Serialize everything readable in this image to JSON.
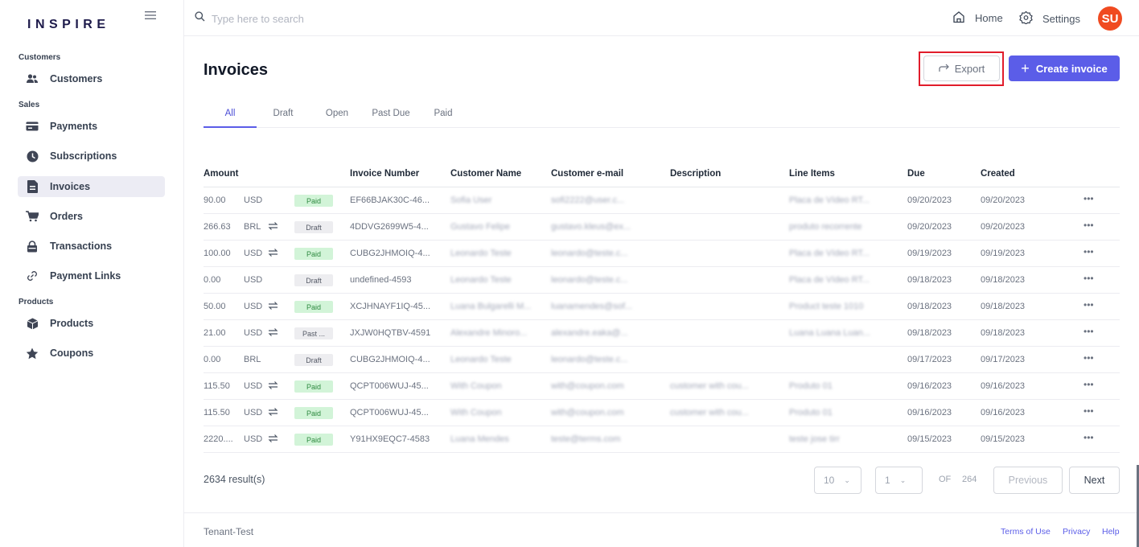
{
  "brand": {
    "logo": "INSPIRE"
  },
  "sidebar": {
    "sections": [
      {
        "label": "Customers",
        "items": [
          {
            "label": "Customers",
            "icon": "users-icon"
          }
        ]
      },
      {
        "label": "Sales",
        "items": [
          {
            "label": "Payments",
            "icon": "credit-card-icon"
          },
          {
            "label": "Subscriptions",
            "icon": "clock-icon"
          },
          {
            "label": "Invoices",
            "icon": "document-icon",
            "active": true
          },
          {
            "label": "Orders",
            "icon": "cart-icon"
          },
          {
            "label": "Transactions",
            "icon": "lock-icon"
          },
          {
            "label": "Payment Links",
            "icon": "link-icon"
          }
        ]
      },
      {
        "label": "Products",
        "items": [
          {
            "label": "Products",
            "icon": "cube-icon"
          },
          {
            "label": "Coupons",
            "icon": "star-icon"
          }
        ]
      }
    ]
  },
  "topbar": {
    "search_placeholder": "Type here to search",
    "home_label": "Home",
    "settings_label": "Settings",
    "avatar_initials": "SU"
  },
  "page": {
    "title": "Invoices",
    "export_label": "Export",
    "create_label": "Create invoice"
  },
  "tabs": [
    "All",
    "Draft",
    "Open",
    "Past Due",
    "Paid"
  ],
  "table": {
    "columns": [
      "Amount",
      "Invoice Number",
      "Customer Name",
      "Customer e-mail",
      "Description",
      "Line Items",
      "Due",
      "Created"
    ],
    "rows": [
      {
        "amount": "90.00",
        "currency": "USD",
        "recurring": false,
        "status": "Paid",
        "invoice": "EF66BJAK30C-46...",
        "name": "Sofia User",
        "email": "sofi2222@user.c...",
        "description": "",
        "line_items": "Placa de Vídeo RT...",
        "due": "09/20/2023",
        "created": "09/20/2023"
      },
      {
        "amount": "266.63",
        "currency": "BRL",
        "recurring": true,
        "status": "Draft",
        "invoice": "4DDVG2699W5-4...",
        "name": "Gustavo Felipe",
        "email": "gustavo.kleus@ex...",
        "description": "",
        "line_items": "produto recorrente",
        "due": "09/20/2023",
        "created": "09/20/2023"
      },
      {
        "amount": "100.00",
        "currency": "USD",
        "recurring": true,
        "status": "Paid",
        "invoice": "CUBG2JHMOIQ-4...",
        "name": "Leonardo Teste",
        "email": "leonardo@teste.c...",
        "description": "",
        "line_items": "Placa de Vídeo RT...",
        "due": "09/19/2023",
        "created": "09/19/2023"
      },
      {
        "amount": "0.00",
        "currency": "USD",
        "recurring": false,
        "status": "Draft",
        "invoice": "undefined-4593",
        "name": "Leonardo Teste",
        "email": "leonardo@teste.c...",
        "description": "",
        "line_items": "Placa de Vídeo RT...",
        "due": "09/18/2023",
        "created": "09/18/2023"
      },
      {
        "amount": "50.00",
        "currency": "USD",
        "recurring": true,
        "status": "Paid",
        "invoice": "XCJHNAYF1IQ-45...",
        "name": "Luana Bulgarelli M...",
        "email": "luanamendes@sof...",
        "description": "",
        "line_items": "Product teste 1010",
        "due": "09/18/2023",
        "created": "09/18/2023"
      },
      {
        "amount": "21.00",
        "currency": "USD",
        "recurring": true,
        "status": "Past ...",
        "invoice": "JXJW0HQTBV-4591",
        "name": "Alexandre Minoro...",
        "email": "alexandre.eaka@...",
        "description": "",
        "line_items": "Luana Luana Luan...",
        "due": "09/18/2023",
        "created": "09/18/2023"
      },
      {
        "amount": "0.00",
        "currency": "BRL",
        "recurring": false,
        "status": "Draft",
        "invoice": "CUBG2JHMOIQ-4...",
        "name": "Leonardo Teste",
        "email": "leonardo@teste.c...",
        "description": "",
        "line_items": "",
        "due": "09/17/2023",
        "created": "09/17/2023"
      },
      {
        "amount": "115.50",
        "currency": "USD",
        "recurring": true,
        "status": "Paid",
        "invoice": "QCPT006WUJ-45...",
        "name": "With Coupon",
        "email": "with@coupon.com",
        "description": "customer with cou...",
        "line_items": "Produto 01",
        "due": "09/16/2023",
        "created": "09/16/2023"
      },
      {
        "amount": "115.50",
        "currency": "USD",
        "recurring": true,
        "status": "Paid",
        "invoice": "QCPT006WUJ-45...",
        "name": "With Coupon",
        "email": "with@coupon.com",
        "description": "customer with cou...",
        "line_items": "Produto 01",
        "due": "09/16/2023",
        "created": "09/16/2023"
      },
      {
        "amount": "2220....",
        "currency": "USD",
        "recurring": true,
        "status": "Paid",
        "invoice": "Y91HX9EQC7-4583",
        "name": "Luana Mendes",
        "email": "teste@terms.com",
        "description": "",
        "line_items": "teste jose tirr",
        "due": "09/15/2023",
        "created": "09/15/2023"
      }
    ]
  },
  "pagination": {
    "results": "2634 result(s)",
    "page_size": "10",
    "page": "1",
    "of_label": "OF",
    "total_pages": "264",
    "prev_label": "Previous",
    "next_label": "Next"
  },
  "footer": {
    "tenant": "Tenant-Test",
    "links": [
      "Terms of Use",
      "Privacy",
      "Help"
    ]
  },
  "colors": {
    "accent": "#5b5de8",
    "avatar": "#f04a20",
    "paid_bg": "#d2f4d8",
    "highlight": "#e11d2b"
  }
}
